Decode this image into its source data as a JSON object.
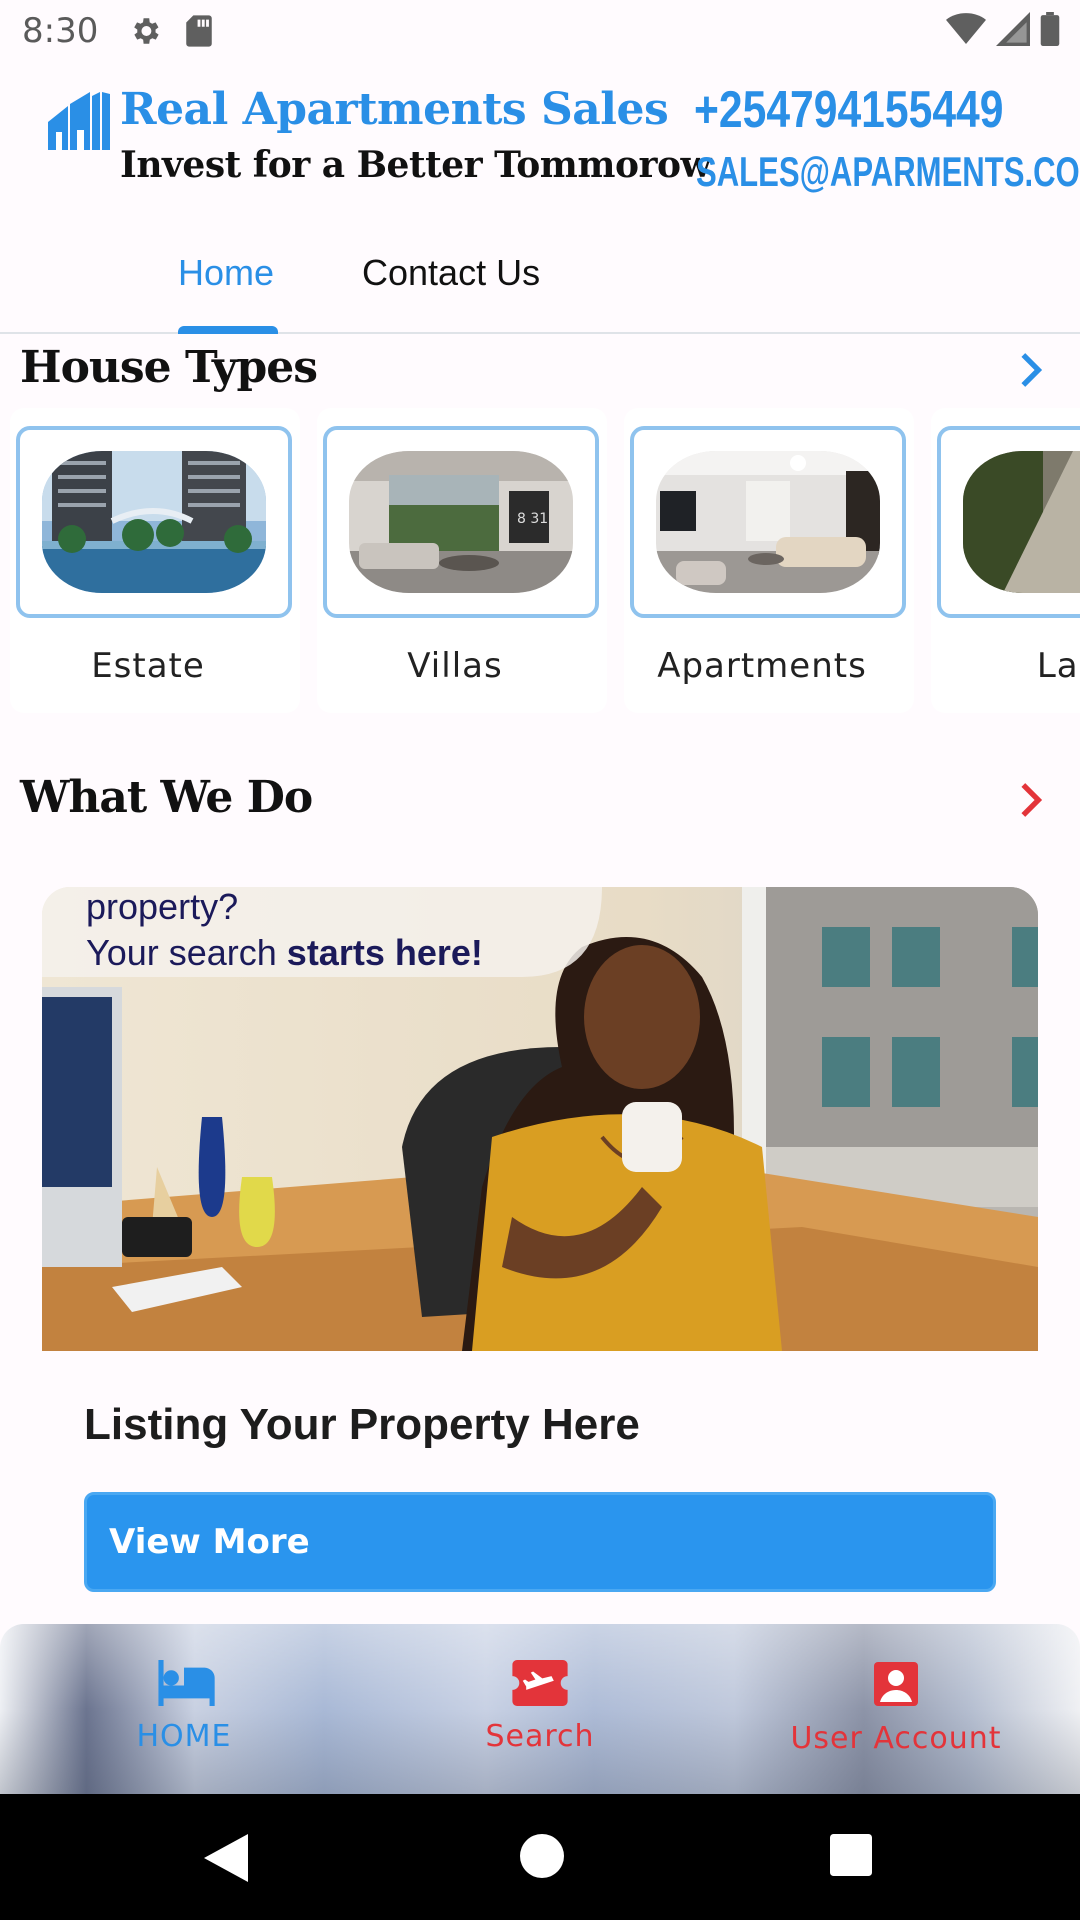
{
  "status_bar": {
    "time": "8:30",
    "left_icons": [
      "gear-icon",
      "sd-card-icon"
    ],
    "right_icons": [
      "wifi-icon",
      "signal-icon",
      "battery-icon"
    ]
  },
  "header": {
    "brand_title": "Real Apartments Sales",
    "tagline": "Invest for a Better Tommorow",
    "phone": "+254794155449",
    "email": "SALES@APARMENTS.COM",
    "logo_icon": "apartment-logo-icon"
  },
  "tabs": [
    {
      "label": "Home",
      "active": true
    },
    {
      "label": "Contact Us",
      "active": false
    }
  ],
  "house_types": {
    "title": "House Types",
    "arrow_icon": "chevron-right-icon",
    "items": [
      {
        "label": "Estate"
      },
      {
        "label": "Villas"
      },
      {
        "label": "Apartments"
      },
      {
        "label": "Lan"
      }
    ]
  },
  "what_we_do": {
    "title": "What We Do",
    "arrow_icon": "chevron-right-icon",
    "image_text_line1": "property?",
    "image_text_line2_prefix": "Your search ",
    "image_text_line2_bold": "starts here!",
    "card_title": "Listing Your Property Here",
    "button_label": "View More"
  },
  "bottom_nav": [
    {
      "label": "HOME",
      "icon": "bed-icon",
      "color": "#2a8fe6"
    },
    {
      "label": "Search",
      "icon": "ticket-plane-icon",
      "color": "#e3343a"
    },
    {
      "label": "User Account",
      "icon": "account-box-icon",
      "color": "#e3343a"
    }
  ],
  "colors": {
    "accent": "#2a8fe6",
    "secondary_arrow": "#e3343a"
  }
}
